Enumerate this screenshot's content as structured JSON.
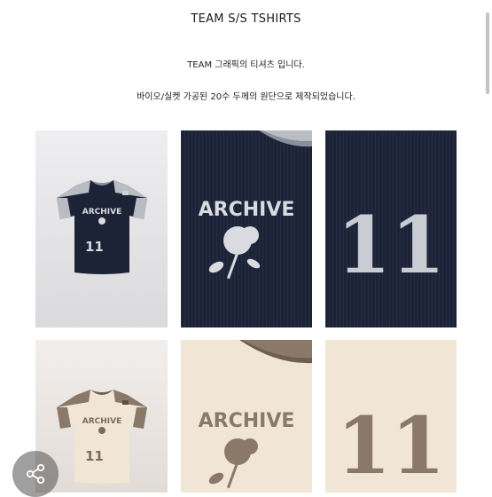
{
  "header": {
    "title": "TEAM S/S TSHIRTS",
    "desc_line1": "TEAM 그래픽의 티셔츠 입니다.",
    "desc_line2": "바이오/실켓 가공된 20수 두께의 원단으로 제작되었습니다."
  },
  "graphics": {
    "archive_text": "ARCHIVE",
    "number_text": "11",
    "tag_text": "AR"
  },
  "colors": {
    "navy": "#1d2337",
    "navy_rib": "#252c45",
    "grey_sleeve": "#b9bcc2",
    "cream": "#f1e6d6",
    "taupe": "#8a7868",
    "photo_bg": "#e4e4e6",
    "photo_bg_warm": "#e9e4e0"
  },
  "share": {
    "icon": "share-icon"
  }
}
